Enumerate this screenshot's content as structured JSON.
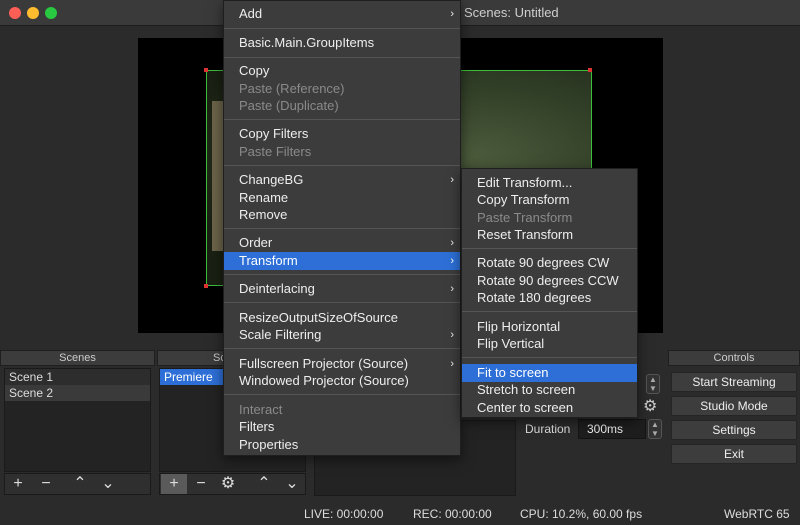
{
  "window": {
    "title": "Scenes: Untitled"
  },
  "docks": {
    "scenes": {
      "title": "Scenes",
      "items": [
        "Scene 1",
        "Scene 2"
      ]
    },
    "sources": {
      "title": "Sources",
      "title_visible": "Sc",
      "items": [
        "Premiere"
      ]
    },
    "controls": {
      "title": "Controls",
      "buttons": [
        "Start Streaming",
        "Studio Mode",
        "Settings",
        "Exit"
      ]
    }
  },
  "transitions": {
    "duration_label": "Duration",
    "duration_value": "300ms"
  },
  "status": {
    "live": "LIVE: 00:00:00",
    "rec": "REC: 00:00:00",
    "cpu": "CPU: 10.2%, 60.00 fps",
    "webrtc": "WebRTC 65"
  },
  "context_menu": {
    "items": [
      {
        "label": "Add",
        "submenu": true
      },
      {
        "label": "Basic.Main.GroupItems"
      },
      {
        "label": "Copy"
      },
      {
        "label": "Paste (Reference)",
        "disabled": true
      },
      {
        "label": "Paste (Duplicate)",
        "disabled": true
      },
      {
        "label": "Copy Filters"
      },
      {
        "label": "Paste Filters",
        "disabled": true
      },
      {
        "label": "ChangeBG",
        "submenu": true
      },
      {
        "label": "Rename"
      },
      {
        "label": "Remove"
      },
      {
        "label": "Order",
        "submenu": true
      },
      {
        "label": "Transform",
        "submenu": true,
        "highlighted": true
      },
      {
        "label": "Deinterlacing",
        "submenu": true
      },
      {
        "label": "ResizeOutputSizeOfSource"
      },
      {
        "label": "Scale Filtering",
        "submenu": true
      },
      {
        "label": "Fullscreen Projector (Source)",
        "submenu": true
      },
      {
        "label": "Windowed Projector (Source)"
      },
      {
        "label": "Interact",
        "disabled": true
      },
      {
        "label": "Filters"
      },
      {
        "label": "Properties"
      }
    ]
  },
  "transform_menu": {
    "items": [
      {
        "label": "Edit Transform..."
      },
      {
        "label": "Copy Transform"
      },
      {
        "label": "Paste Transform",
        "disabled": true
      },
      {
        "label": "Reset Transform"
      },
      {
        "label": "Rotate 90 degrees CW"
      },
      {
        "label": "Rotate 90 degrees CCW"
      },
      {
        "label": "Rotate 180 degrees"
      },
      {
        "label": "Flip Horizontal"
      },
      {
        "label": "Flip Vertical"
      },
      {
        "label": "Fit to screen",
        "highlighted": true
      },
      {
        "label": "Stretch to screen"
      },
      {
        "label": "Center to screen"
      }
    ]
  },
  "icons": {
    "submenu_arrow": "›",
    "add": "+",
    "remove": "−",
    "up": "⌃",
    "down": "⌄",
    "gear": "⚙"
  },
  "colors": {
    "highlight": "#2d6fd6",
    "selection_box": "#3bbf3b"
  }
}
